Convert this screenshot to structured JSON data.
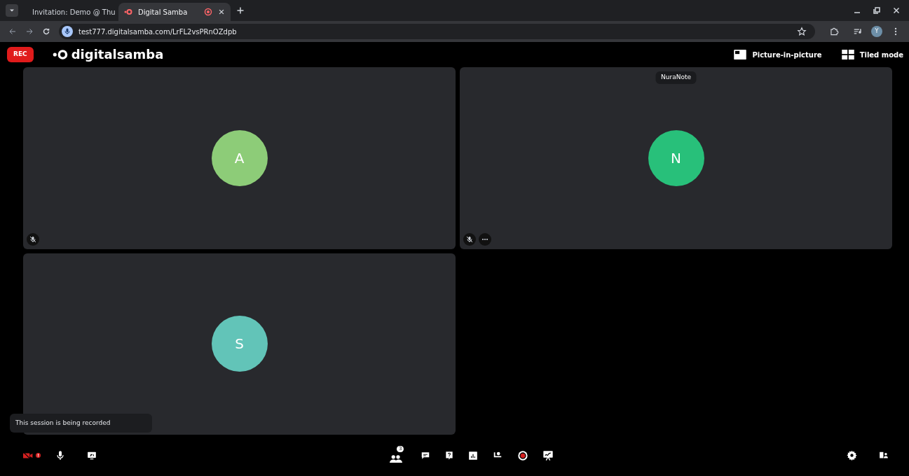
{
  "browser": {
    "tabs": [
      {
        "title": "Invitation: Demo @ Thu",
        "selected": false,
        "kind": "mail"
      },
      {
        "title": "Digital Samba",
        "selected": true,
        "kind": "samba"
      }
    ],
    "url": "test777.digitalsamba.com/LrFL2vsPRnOZdpb",
    "profile_initial": "Y"
  },
  "header": {
    "rec_badge": "REC",
    "logo": "digitalsamba",
    "buttons": [
      {
        "label": "Picture-in-picture",
        "kind": "pip"
      },
      {
        "label": "Tiled mode",
        "kind": "tiled"
      }
    ]
  },
  "tiles": [
    {
      "initial": "A",
      "color": "#8dcc78",
      "muted": true,
      "more": false
    },
    {
      "initial": "N",
      "color": "#28c07a",
      "name": "NuraNote",
      "muted": true,
      "more": true
    },
    {
      "initial": "S",
      "color": "#62c4b8"
    }
  ],
  "toast": "This session is being recorded",
  "toolbar": {
    "camera_off": true,
    "participants_count": "3"
  }
}
